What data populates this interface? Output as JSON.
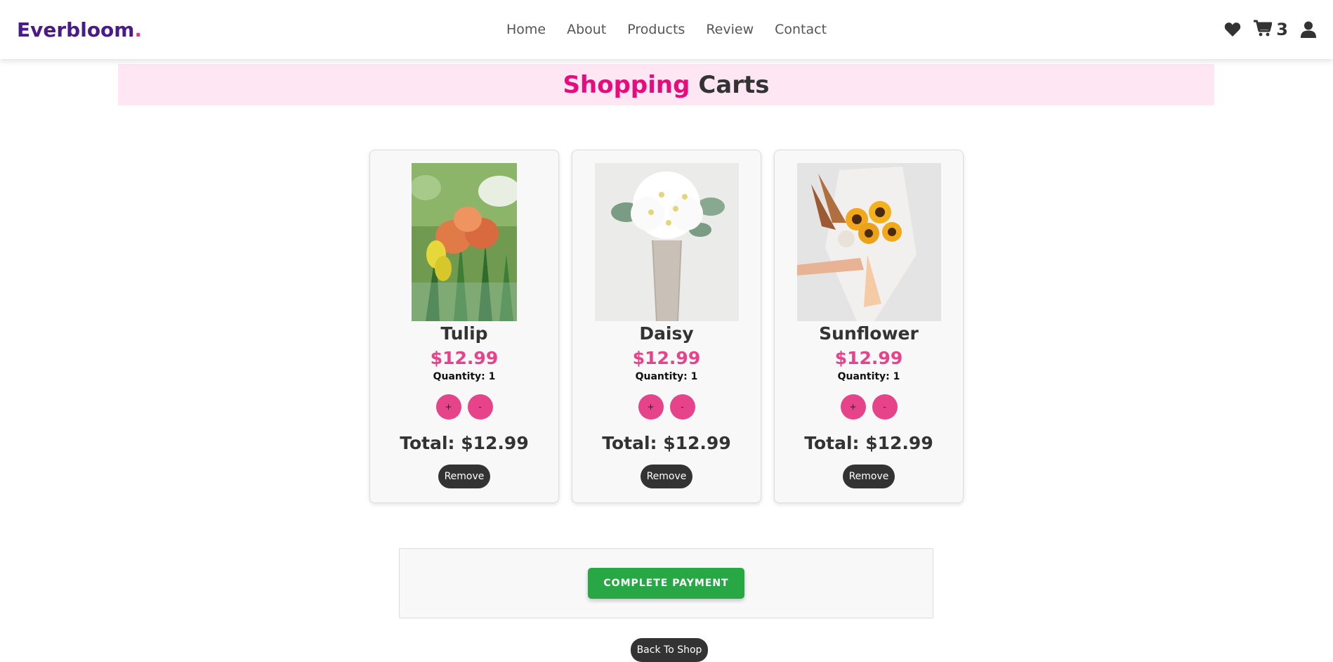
{
  "navbar": {
    "logo": "Everbloom",
    "logo_dot": ".",
    "links": [
      "Home",
      "About",
      "Products",
      "Review",
      "Contact"
    ],
    "icons": [
      "heart-icon",
      "cart-icon",
      "user-icon"
    ],
    "cart_count": "3"
  },
  "banner": {
    "title_accent": "Shopping",
    "title_rest": "Carts"
  },
  "cart": {
    "items": [
      {
        "name": "Tulip",
        "price": "$12.99",
        "quantity": "Quantity: 1",
        "plus": "+",
        "minus": "-",
        "total": "Total: $12.99",
        "remove": "Remove"
      },
      {
        "name": "Daisy",
        "price": "$12.99",
        "quantity": "Quantity: 1",
        "plus": "+",
        "minus": "-",
        "total": "Total: $12.99",
        "remove": "Remove"
      },
      {
        "name": "Sunflower",
        "price": "$12.99",
        "quantity": "Quantity: 1",
        "plus": "+",
        "minus": "-",
        "total": "Total: $12.99",
        "remove": "Remove"
      }
    ]
  },
  "payment": {
    "button_label": "COMPLETE PAYMENT"
  },
  "footer": {
    "back_label": "Back To Shop"
  },
  "colors": {
    "brand": "#4b1a8a",
    "accent_pink": "#e90a7b",
    "price_pink": "#e6438b",
    "pay_green": "#28a745",
    "dark": "#333333"
  }
}
